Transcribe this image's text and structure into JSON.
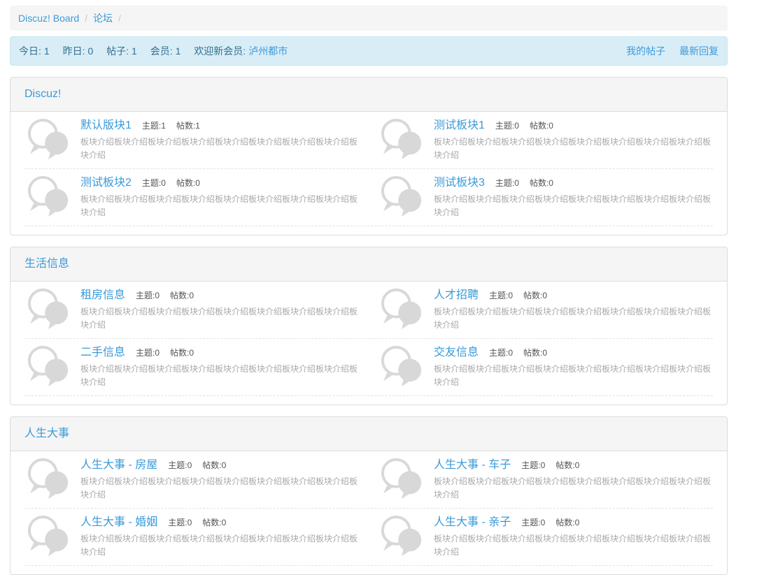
{
  "colors": {
    "link_blue": "#3a9ad9",
    "stats_bg": "#d9edf7",
    "stats_text": "#31708f",
    "panel_header_bg": "#f5f5f5",
    "panel_border": "#dcdcdc",
    "desc_gray": "#a9a9a9"
  },
  "breadcrumb": {
    "separator": "/",
    "items": [
      {
        "label": "Discuz! Board"
      },
      {
        "label": "论坛"
      }
    ]
  },
  "stats_bar": {
    "stats": [
      {
        "label": "今日:",
        "value": "1"
      },
      {
        "label": "昨日:",
        "value": "0"
      },
      {
        "label": "帖子:",
        "value": "1"
      },
      {
        "label": "会员:",
        "value": "1"
      }
    ],
    "welcome_label": "欢迎新会员:",
    "welcome_user": "泸州都市",
    "links": [
      {
        "label": "我的帖子"
      },
      {
        "label": "最新回复"
      }
    ]
  },
  "labels": {
    "topics": "主题:",
    "posts": "帖数:"
  },
  "categories": [
    {
      "title": "Discuz!",
      "forums": [
        {
          "name": "默认版块1",
          "topics": "1",
          "posts": "1",
          "description": "板块介绍板块介绍板块介绍板块介绍板块介绍板块介绍板块介绍板块介绍板块介绍"
        },
        {
          "name": "测试板块1",
          "topics": "0",
          "posts": "0",
          "description": "板块介绍板块介绍板块介绍板块介绍板块介绍板块介绍板块介绍板块介绍板块介绍"
        },
        {
          "name": "测试板块2",
          "topics": "0",
          "posts": "0",
          "description": "板块介绍板块介绍板块介绍板块介绍板块介绍板块介绍板块介绍板块介绍板块介绍"
        },
        {
          "name": "测试板块3",
          "topics": "0",
          "posts": "0",
          "description": "板块介绍板块介绍板块介绍板块介绍板块介绍板块介绍板块介绍板块介绍板块介绍"
        }
      ]
    },
    {
      "title": "生活信息",
      "forums": [
        {
          "name": "租房信息",
          "topics": "0",
          "posts": "0",
          "description": "板块介绍板块介绍板块介绍板块介绍板块介绍板块介绍板块介绍板块介绍板块介绍"
        },
        {
          "name": "人才招聘",
          "topics": "0",
          "posts": "0",
          "description": "板块介绍板块介绍板块介绍板块介绍板块介绍板块介绍板块介绍板块介绍板块介绍"
        },
        {
          "name": "二手信息",
          "topics": "0",
          "posts": "0",
          "description": "板块介绍板块介绍板块介绍板块介绍板块介绍板块介绍板块介绍板块介绍板块介绍"
        },
        {
          "name": "交友信息",
          "topics": "0",
          "posts": "0",
          "description": "板块介绍板块介绍板块介绍板块介绍板块介绍板块介绍板块介绍板块介绍板块介绍"
        }
      ]
    },
    {
      "title": "人生大事",
      "forums": [
        {
          "name": "人生大事 - 房屋",
          "topics": "0",
          "posts": "0",
          "description": "板块介绍板块介绍板块介绍板块介绍板块介绍板块介绍板块介绍板块介绍板块介绍"
        },
        {
          "name": "人生大事 - 车子",
          "topics": "0",
          "posts": "0",
          "description": "板块介绍板块介绍板块介绍板块介绍板块介绍板块介绍板块介绍板块介绍板块介绍"
        },
        {
          "name": "人生大事 - 婚姻",
          "topics": "0",
          "posts": "0",
          "description": "板块介绍板块介绍板块介绍板块介绍板块介绍板块介绍板块介绍板块介绍板块介绍"
        },
        {
          "name": "人生大事 - 亲子",
          "topics": "0",
          "posts": "0",
          "description": "板块介绍板块介绍板块介绍板块介绍板块介绍板块介绍板块介绍板块介绍板块介绍"
        }
      ]
    }
  ]
}
